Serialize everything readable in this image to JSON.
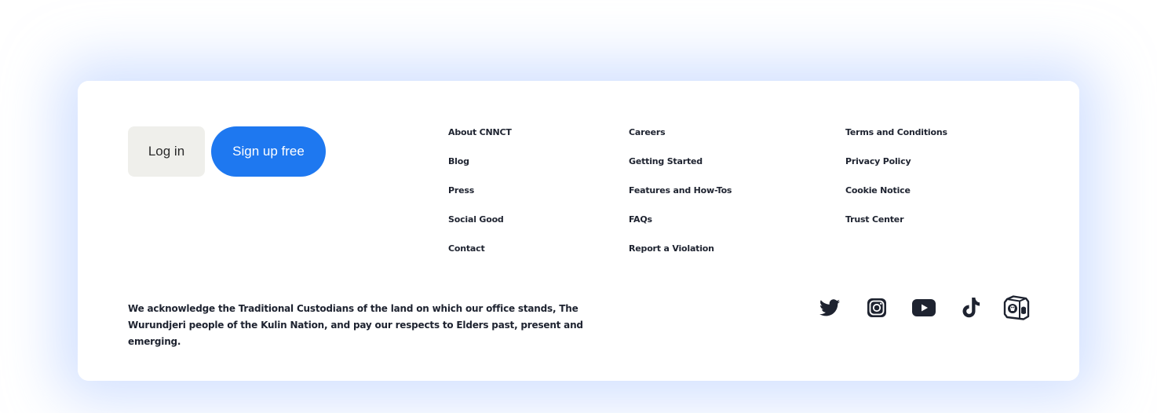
{
  "auth": {
    "login_label": "Log in",
    "signup_label": "Sign up free"
  },
  "links": {
    "col1": [
      "About CNNCT",
      "Blog",
      "Press",
      "Social Good",
      "Contact"
    ],
    "col2": [
      "Careers",
      "Getting Started",
      "Features and How-Tos",
      "FAQs",
      "Report a Violation"
    ],
    "col3": [
      "Terms and Conditions",
      "Privacy Policy",
      "Cookie Notice",
      "Trust Center"
    ]
  },
  "acknowledgement": "We acknowledge the Traditional Custodians of the land on which our office stands, The Wurundjeri people of the Kulin Nation, and pay our respects to Elders past, present and emerging.",
  "social": {
    "icons": [
      "twitter-icon",
      "instagram-icon",
      "youtube-icon",
      "tiktok-icon",
      "badge-icon"
    ]
  },
  "colors": {
    "accent": "#1e78f0",
    "login_bg": "#efefeb",
    "text": "#1e2330",
    "glow": "#afc8ff"
  }
}
